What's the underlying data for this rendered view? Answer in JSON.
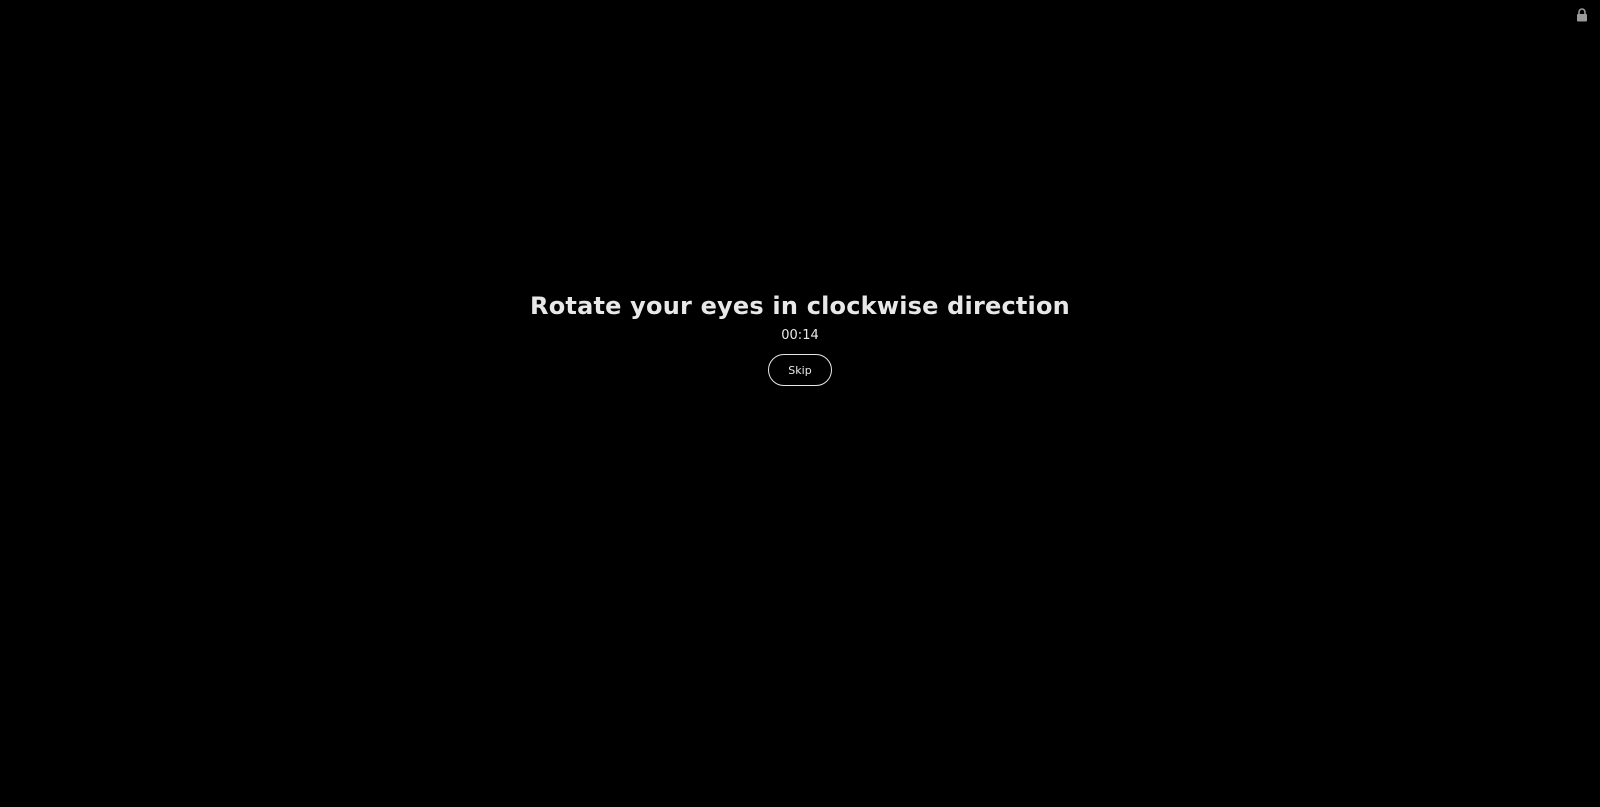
{
  "break_screen": {
    "title": "Rotate your eyes in clockwise direction",
    "timer": "00:14",
    "skip_label": "Skip",
    "lock_icon": "lock-icon"
  },
  "colors": {
    "background": "#000000",
    "text": "#e8e8e8"
  }
}
